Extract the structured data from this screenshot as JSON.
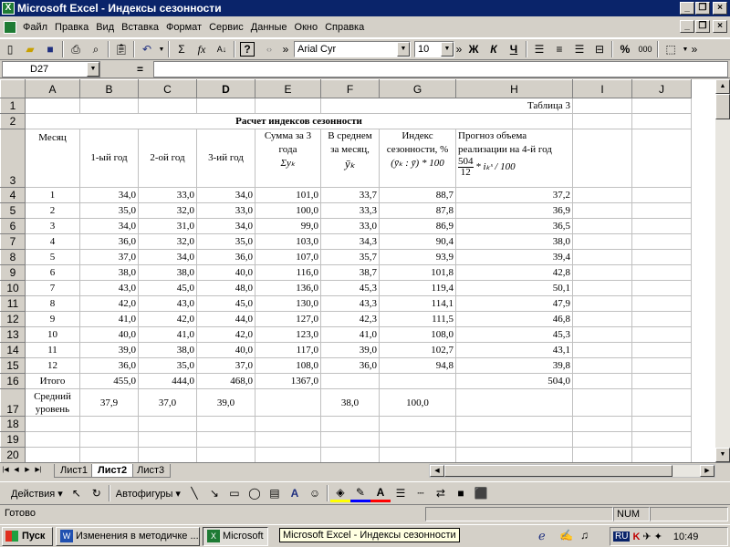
{
  "window": {
    "title": "Microsoft Excel - Индексы сезонности"
  },
  "menu": [
    "Файл",
    "Правка",
    "Вид",
    "Вставка",
    "Формат",
    "Сервис",
    "Данные",
    "Окно",
    "Справка"
  ],
  "toolbar": {
    "font": "Arial Cyr",
    "size": "10",
    "sigma": "Σ",
    "fx": "fx",
    "bold": "Ж",
    "italic": "К",
    "underline": "Ч",
    "percent": "%",
    "help_text": "?"
  },
  "formula_bar": {
    "cell": "D27",
    "equals": "=",
    "value": ""
  },
  "columns": [
    "A",
    "B",
    "C",
    "D",
    "E",
    "F",
    "G",
    "H",
    "I",
    "J"
  ],
  "rows": [
    {
      "n": "1",
      "cells": [
        "",
        "",
        "",
        "",
        "",
        "",
        "",
        "Таблица 3",
        "",
        ""
      ]
    },
    {
      "n": "2",
      "cells": [
        "",
        "",
        "",
        "",
        "",
        "",
        "",
        "",
        "",
        ""
      ]
    },
    {
      "n": "3",
      "cells": [
        "",
        "",
        "",
        "",
        "",
        "",
        "",
        "",
        "",
        ""
      ]
    },
    {
      "n": "4",
      "cells": [
        "1",
        "34,0",
        "33,0",
        "34,0",
        "101,0",
        "33,7",
        "88,7",
        "37,2",
        "",
        ""
      ]
    },
    {
      "n": "5",
      "cells": [
        "2",
        "35,0",
        "32,0",
        "33,0",
        "100,0",
        "33,3",
        "87,8",
        "36,9",
        "",
        ""
      ]
    },
    {
      "n": "6",
      "cells": [
        "3",
        "34,0",
        "31,0",
        "34,0",
        "99,0",
        "33,0",
        "86,9",
        "36,5",
        "",
        ""
      ]
    },
    {
      "n": "7",
      "cells": [
        "4",
        "36,0",
        "32,0",
        "35,0",
        "103,0",
        "34,3",
        "90,4",
        "38,0",
        "",
        ""
      ]
    },
    {
      "n": "8",
      "cells": [
        "5",
        "37,0",
        "34,0",
        "36,0",
        "107,0",
        "35,7",
        "93,9",
        "39,4",
        "",
        ""
      ]
    },
    {
      "n": "9",
      "cells": [
        "6",
        "38,0",
        "38,0",
        "40,0",
        "116,0",
        "38,7",
        "101,8",
        "42,8",
        "",
        ""
      ]
    },
    {
      "n": "10",
      "cells": [
        "7",
        "43,0",
        "45,0",
        "48,0",
        "136,0",
        "45,3",
        "119,4",
        "50,1",
        "",
        ""
      ]
    },
    {
      "n": "11",
      "cells": [
        "8",
        "42,0",
        "43,0",
        "45,0",
        "130,0",
        "43,3",
        "114,1",
        "47,9",
        "",
        ""
      ]
    },
    {
      "n": "12",
      "cells": [
        "9",
        "41,0",
        "42,0",
        "44,0",
        "127,0",
        "42,3",
        "111,5",
        "46,8",
        "",
        ""
      ]
    },
    {
      "n": "13",
      "cells": [
        "10",
        "40,0",
        "41,0",
        "42,0",
        "123,0",
        "41,0",
        "108,0",
        "45,3",
        "",
        ""
      ]
    },
    {
      "n": "14",
      "cells": [
        "11",
        "39,0",
        "38,0",
        "40,0",
        "117,0",
        "39,0",
        "102,7",
        "43,1",
        "",
        ""
      ]
    },
    {
      "n": "15",
      "cells": [
        "12",
        "36,0",
        "35,0",
        "37,0",
        "108,0",
        "36,0",
        "94,8",
        "39,8",
        "",
        ""
      ]
    },
    {
      "n": "16",
      "cells": [
        "Итого",
        "455,0",
        "444,0",
        "468,0",
        "1367,0",
        "",
        "",
        "504,0",
        "",
        ""
      ]
    },
    {
      "n": "17",
      "cells": [
        "Средний уровень",
        "37,9",
        "37,0",
        "39,0",
        "",
        "38,0",
        "100,0",
        "",
        "",
        ""
      ]
    },
    {
      "n": "18",
      "cells": [
        "",
        "",
        "",
        "",
        "",
        "",
        "",
        "",
        "",
        ""
      ]
    },
    {
      "n": "19",
      "cells": [
        "",
        "",
        "",
        "",
        "",
        "",
        "",
        "",
        "",
        ""
      ]
    },
    {
      "n": "20",
      "cells": [
        "",
        "",
        "",
        "",
        "",
        "",
        "",
        "",
        "",
        ""
      ]
    }
  ],
  "table_title": "Расчет индексов сезонности",
  "headers": {
    "month": "Месяц",
    "y1": "1-ый год",
    "y2": "2-ой год",
    "y3": "3-ий год",
    "sum": "Сумма за 3 года",
    "sum_formula": "Σyₖ",
    "avg1": "В среднем",
    "avg2": "за месяц,",
    "avg_formula": "ȳₖ",
    "idx1": "Индекс",
    "idx2": "сезонности, %",
    "idx_formula": "(ȳₖ : ȳ) * 100",
    "fc1": "Прогноз объема",
    "fc2": "реализации на 4-й год",
    "fc_num": "504",
    "fc_den": "12",
    "fc_tail": "* iₖˢ / 100"
  },
  "sheets": [
    "Лист1",
    "Лист2",
    "Лист3"
  ],
  "active_sheet": "Лист2",
  "drawing": {
    "actions": "Действия",
    "autoshapes": "Автофигуры"
  },
  "status": {
    "ready": "Готово",
    "num": "NUM"
  },
  "taskbar": {
    "start": "Пуск",
    "task1": "Изменения в методичке ...",
    "task2": "Microsoft",
    "tooltip": "Microsoft Excel - Индексы сезонности",
    "lang": "RU",
    "time": "10:49"
  }
}
